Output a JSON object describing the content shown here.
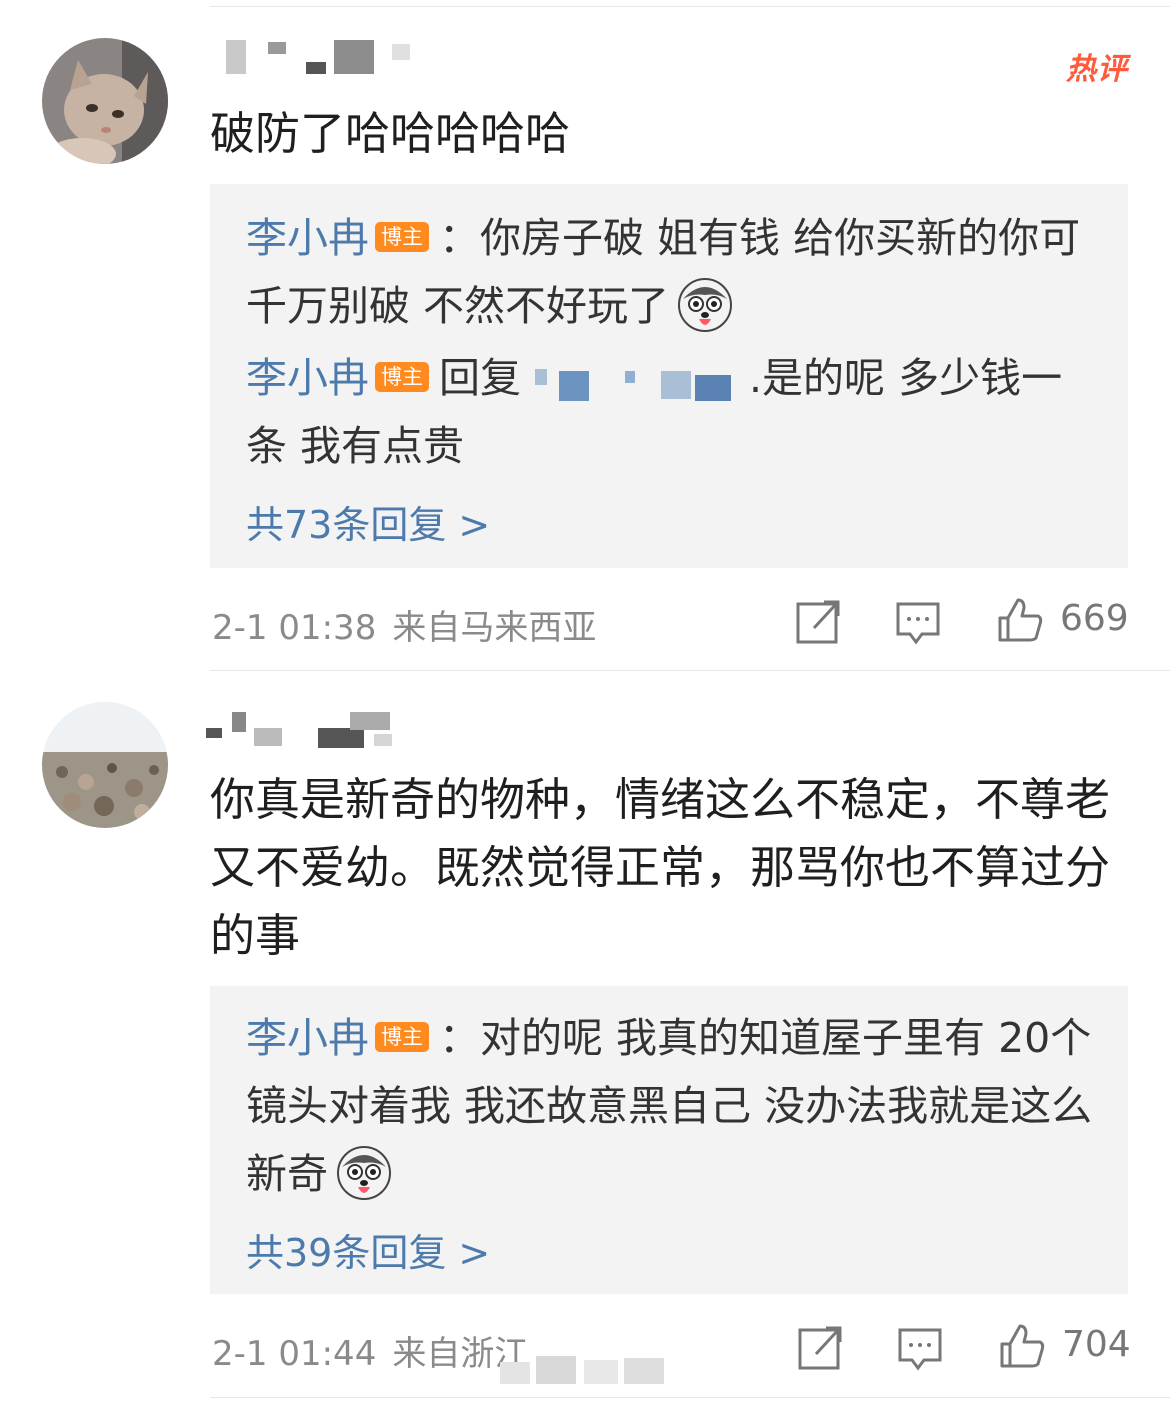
{
  "comments": [
    {
      "body": "破防了哈哈哈哈哈",
      "hot_label": "热评",
      "replies": [
        {
          "author": "李小冉",
          "tag": "博主",
          "sep": "：",
          "text": "你房子破 姐有钱 给你买新的你可千万别破 不然不好玩了"
        },
        {
          "author": "李小冉",
          "tag": "博主",
          "prefix": "回复",
          "text": ".是的呢 多少钱一条 我有点贵"
        }
      ],
      "more_label": "共73条回复 >",
      "time": "2-1 01:38",
      "location": "来自马来西亚",
      "likes": "669"
    },
    {
      "body": "你真是新奇的物种，情绪这么不稳定，不尊老又不爱幼。既然觉得正常，那骂你也不算过分的事",
      "replies": [
        {
          "author": "李小冉",
          "tag": "博主",
          "sep": "：",
          "text": "对的呢 我真的知道屋子里有 20个镜头对着我 我还故意黑自己 没办法我就是这么新奇"
        }
      ],
      "more_label": "共39条回复 >",
      "time": "2-1 01:44",
      "location": "来自浙江",
      "likes": "704"
    }
  ],
  "icons": {
    "repost": "share-icon",
    "comment": "comment-icon",
    "like": "thumbs-up-icon",
    "emoji": "husky-emoji-icon"
  },
  "colors": {
    "name_link": "#4d7aac",
    "tag_bg": "#ff8a1f",
    "hot": "#ff5a3c",
    "reply_bg": "#f3f3f3",
    "meta": "#8a8a8a"
  }
}
